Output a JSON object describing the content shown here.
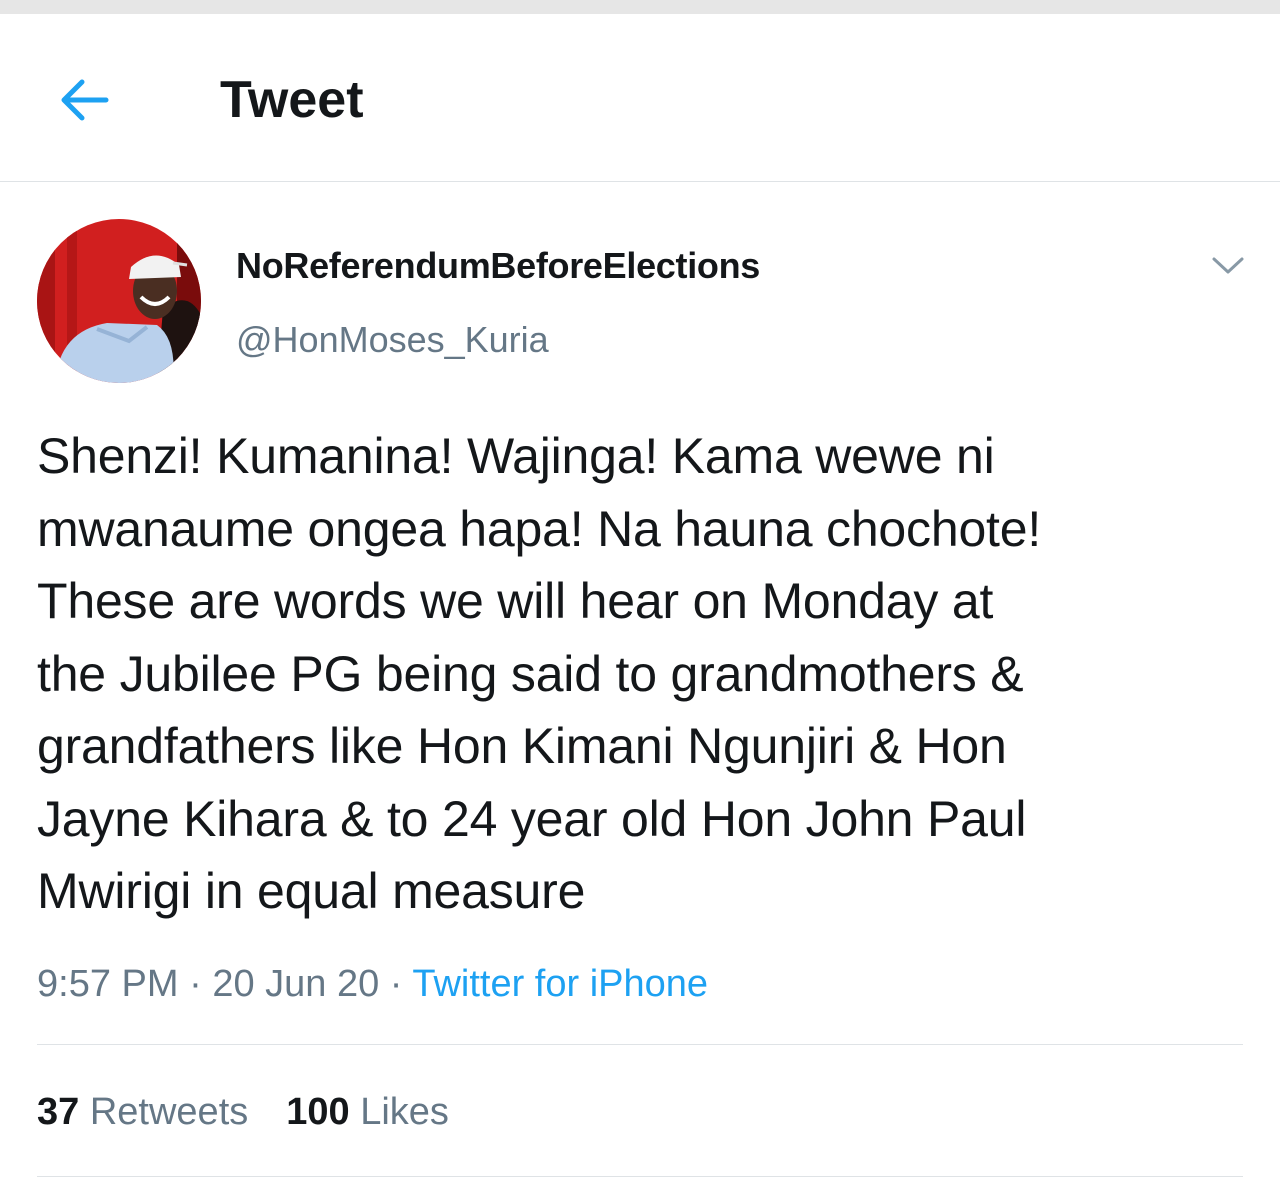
{
  "header": {
    "title": "Tweet"
  },
  "icons": {
    "back": "arrow-left-icon",
    "more": "chevron-down-icon"
  },
  "tweet": {
    "display_name": "NoReferendumBeforeElections",
    "handle": "@HonMoses_Kuria",
    "text": "Shenzi! Kumanina! Wajinga! Kama wewe ni\nmwanaume ongea hapa! Na hauna chochote!\nThese are words we will hear on Monday at\nthe Jubilee PG being said to grandmothers &\ngrandfathers like Hon Kimani Ngunjiri & Hon\nJayne Kihara & to 24 year old Hon John Paul\nMwirigi in equal measure",
    "time": "9:57 PM",
    "date": "20 Jun 20",
    "source": "Twitter for iPhone",
    "separator": "·"
  },
  "stats": {
    "retweets_count": "37",
    "retweets_label": "Retweets",
    "likes_count": "100",
    "likes_label": "Likes"
  },
  "colors": {
    "accent": "#1da1f2",
    "text_primary": "#14171a",
    "text_secondary": "#657786",
    "divider": "#dfe3e6"
  }
}
